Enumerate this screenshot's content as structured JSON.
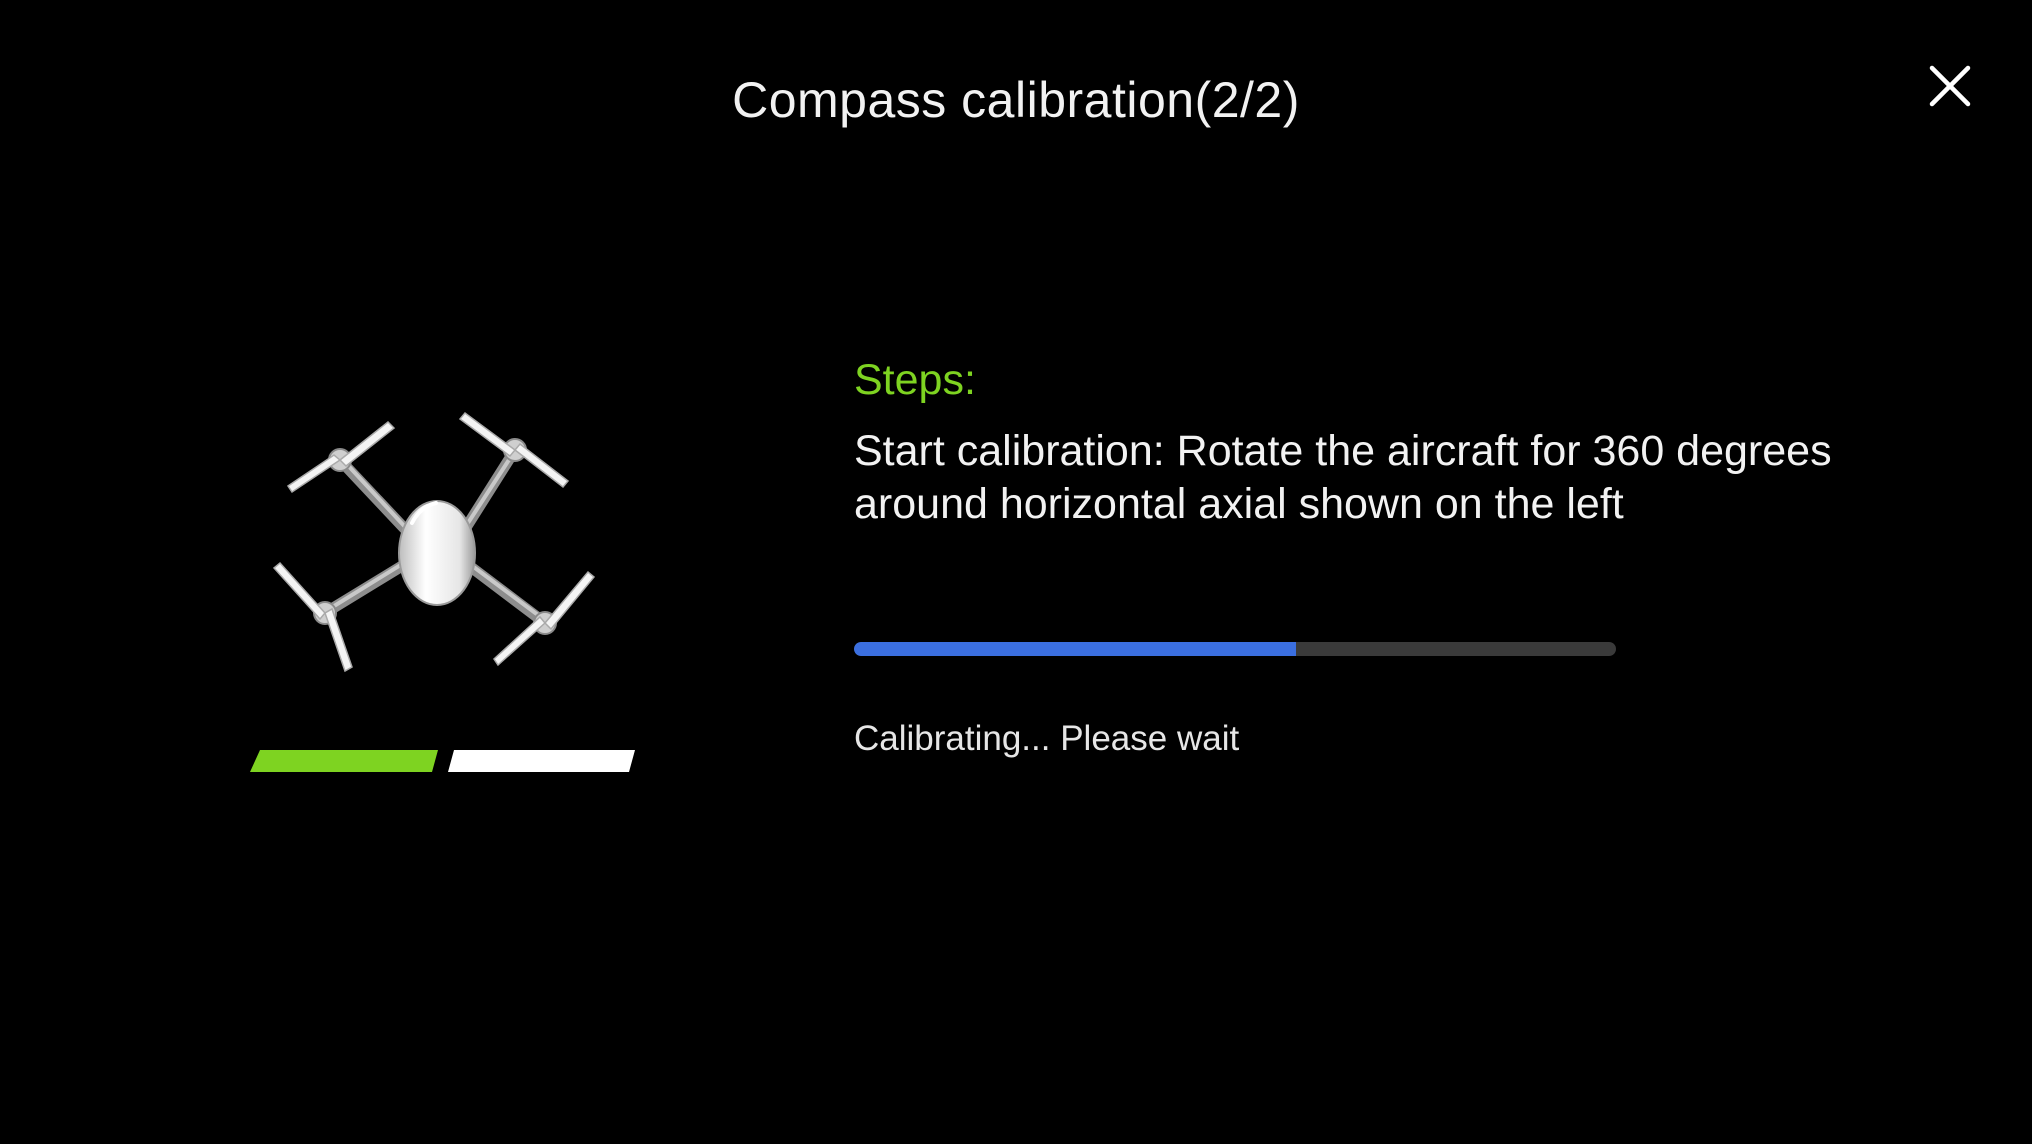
{
  "dialog": {
    "title": "Compass calibration(2/2)",
    "close_icon": "close-icon"
  },
  "illustration": {
    "icon": "drone-icon",
    "steps_completed": 1,
    "steps_total": 2,
    "step_colors": {
      "done": "#7ed321",
      "pending": "#ffffff"
    }
  },
  "content": {
    "steps_heading": "Steps:",
    "instruction": "Start calibration: Rotate the aircraft for 360 degrees around horizontal axial shown on the left",
    "progress": 0.58,
    "status": "Calibrating... Please wait"
  },
  "colors": {
    "background": "#000000",
    "accent_green": "#7ed321",
    "progress_blue": "#3b6fe0",
    "track": "#3a3a3a"
  }
}
